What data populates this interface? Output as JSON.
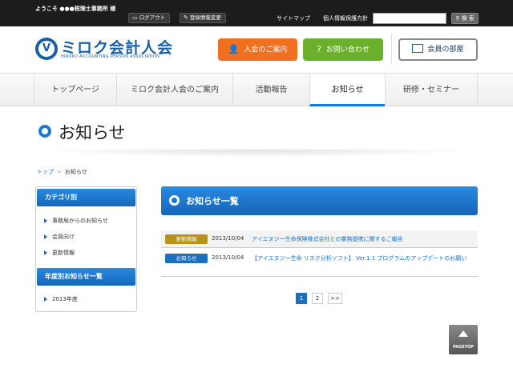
{
  "topbar": {
    "welcome": "ようこそ ●●●税理士事務所 様",
    "logout_label": "ログアウト",
    "profile_label": "登録情報変更",
    "sitemap_label": "サイトマップ",
    "privacy_label": "個人情報保護方針",
    "search_placeholder": "",
    "search_button": "検 索"
  },
  "header": {
    "logo_text": "ミロク会計人会",
    "logo_sub": "HIROKU ACCOUNTING PERSON ASSOCIATION",
    "join_button": "入会のご案内",
    "contact_button": "お問い合わせ",
    "member_button": "会員の部屋"
  },
  "nav": {
    "items": [
      {
        "label": "トップページ"
      },
      {
        "label": "ミロク会計人会のご案内"
      },
      {
        "label": "活動報告"
      },
      {
        "label": "お知らせ"
      },
      {
        "label": "研修・セミナー"
      }
    ],
    "active_index": 3
  },
  "page": {
    "title": "お知らせ",
    "breadcrumb": {
      "home": "トップ",
      "separator": ">",
      "current": "お知らせ"
    }
  },
  "sidebar": {
    "category_title": "カテゴリ別",
    "categories": [
      "事務局からのお知らせ",
      "会員向け",
      "更新情報"
    ],
    "yearly_title": "年度別お知らせ一覧",
    "years": [
      "2013年度"
    ]
  },
  "main": {
    "heading": "お知らせ一覧",
    "news": [
      {
        "badge": "更新情報",
        "date": "2013/10/04",
        "title": "アイエヌジー生命保険株式会社との業務提携に関するご報告"
      },
      {
        "badge": "お知らせ",
        "date": "2013/10/04",
        "title": "【アイエヌジー生命 リスク分析ソフト】 Ver.1.1 プログラムのアップデートのお願い"
      }
    ],
    "pagination": {
      "pages": [
        "1",
        "2"
      ],
      "next": ">>",
      "current": "1"
    }
  },
  "pagetop_label": "PAGETOP",
  "colors": {
    "accent_blue": "#1a6fc0",
    "orange": "#f07020",
    "green": "#6ab02a",
    "badge_gold": "#b8951a"
  }
}
